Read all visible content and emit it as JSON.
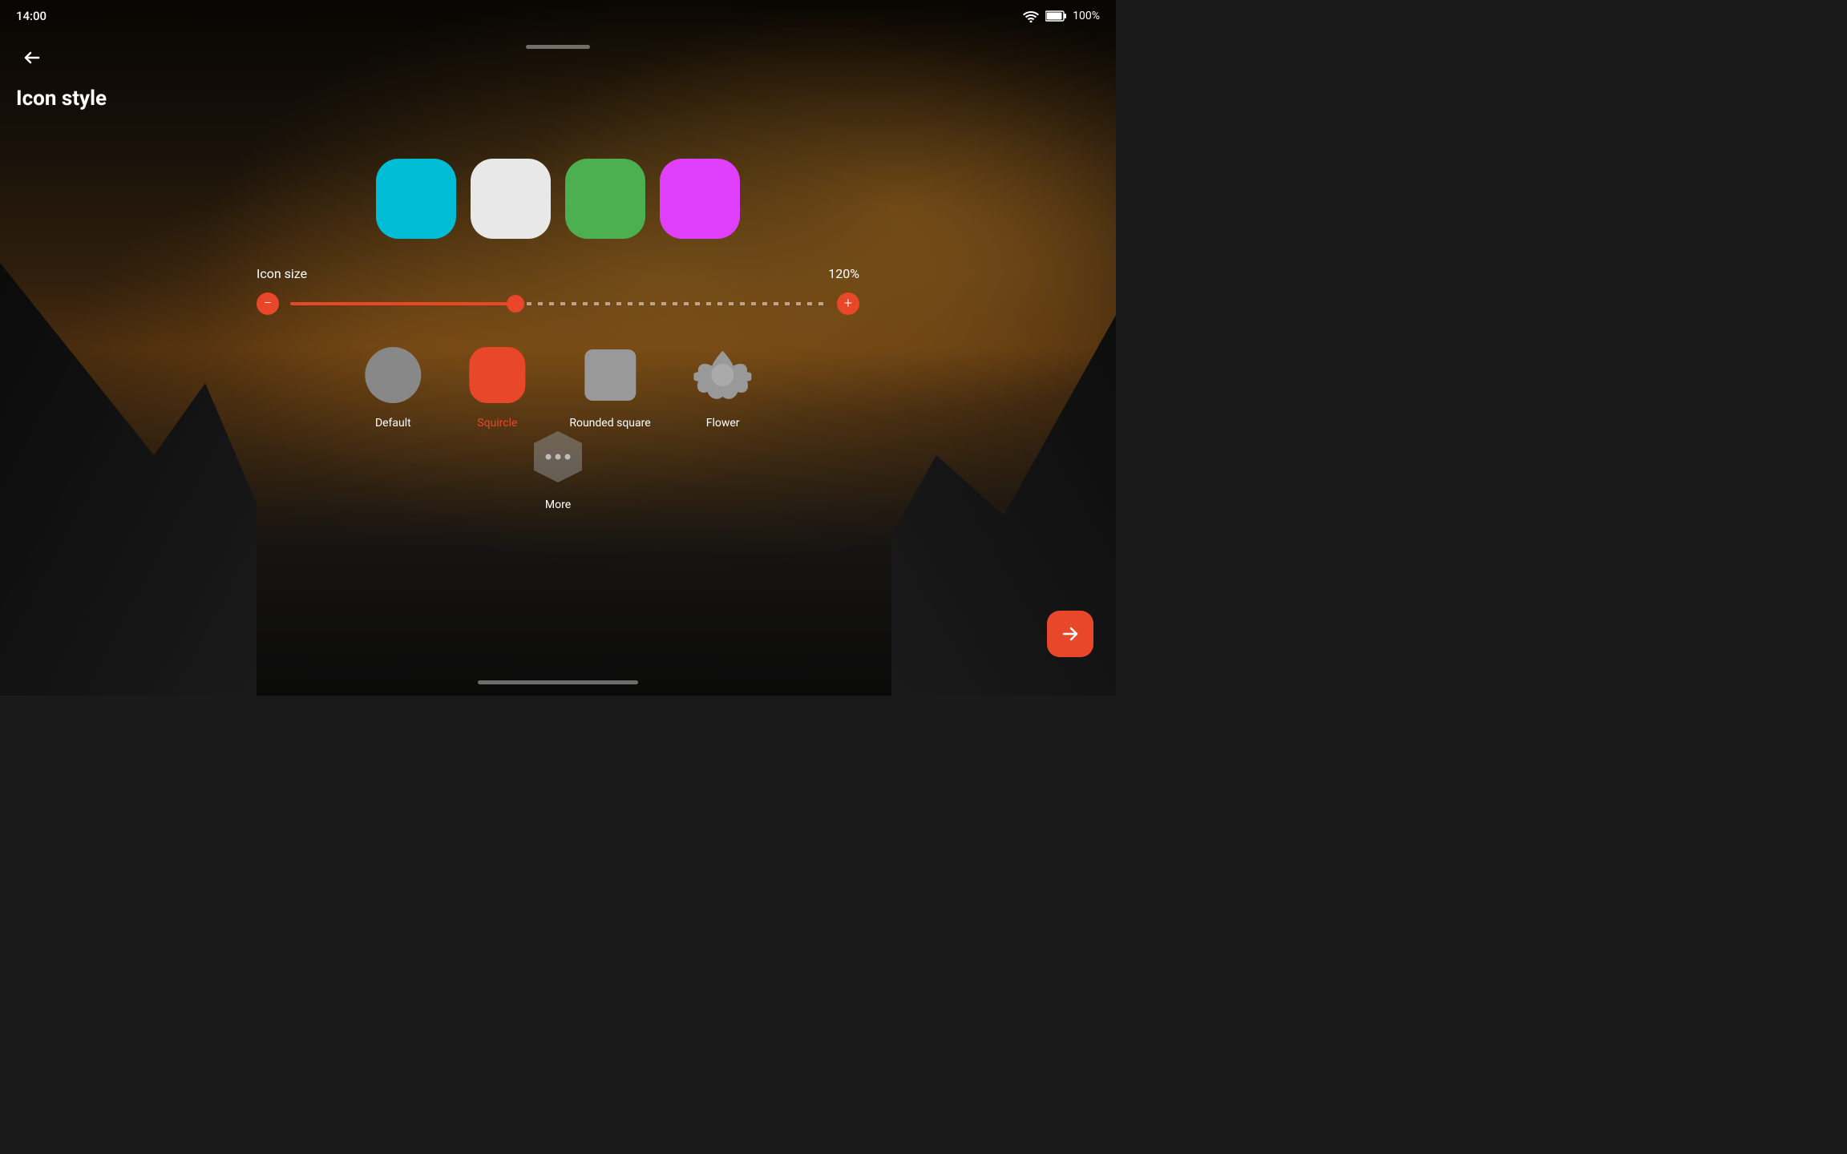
{
  "statusBar": {
    "time": "14:00",
    "battery": "100%"
  },
  "header": {
    "title": "Icon style",
    "back_label": "←"
  },
  "colors": {
    "cyan": "#00BCD4",
    "white": "#E8E8E8",
    "green": "#4CAF50",
    "magenta": "#E040FB"
  },
  "iconSize": {
    "label": "Icon size",
    "value": "120%",
    "min_icon": "−",
    "max_icon": "+"
  },
  "iconStyles": [
    {
      "id": "default",
      "label": "Default",
      "selected": false
    },
    {
      "id": "squircle",
      "label": "Squircle",
      "selected": true
    },
    {
      "id": "rounded-square",
      "label": "Rounded square",
      "selected": false
    },
    {
      "id": "flower",
      "label": "Flower",
      "selected": false
    }
  ],
  "more": {
    "label": "More"
  },
  "fab": {
    "label": "→"
  }
}
